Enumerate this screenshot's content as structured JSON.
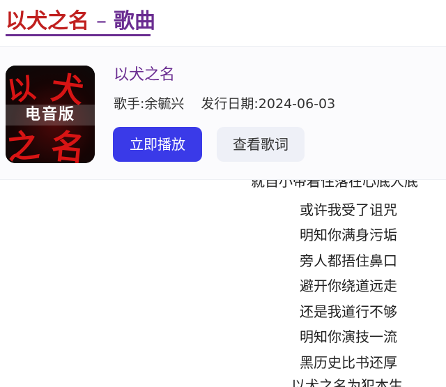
{
  "header": {
    "title": "以犬之名",
    "separator": "–",
    "subtitle": "歌曲"
  },
  "song": {
    "name": "以犬之名",
    "singer": "歌手:余毓兴",
    "release": "发行日期:2024-06-03",
    "cover_text": {
      "c1": "以",
      "c2": "犬",
      "c3": "之",
      "c4": "名",
      "edition": "电音版"
    }
  },
  "actions": {
    "play_label": "立即播放",
    "lyrics_label": "查看歌词"
  },
  "lyrics": {
    "partial_top": "就自小带着住落在心底人底",
    "lines": [
      "或许我受了诅咒",
      "明知你满身污垢",
      "旁人都捂住鼻口",
      "避开你绕道远走",
      "还是我道行不够",
      "明知你演技一流",
      "黑历史比书还厚"
    ],
    "partial_bottom": "以犬之名为犯本生"
  },
  "colors": {
    "title_red": "#c0201f",
    "accent_purple": "#6a2d91",
    "play_button": "#3a3ae8",
    "lyrics_button_bg": "#eef0f7"
  }
}
